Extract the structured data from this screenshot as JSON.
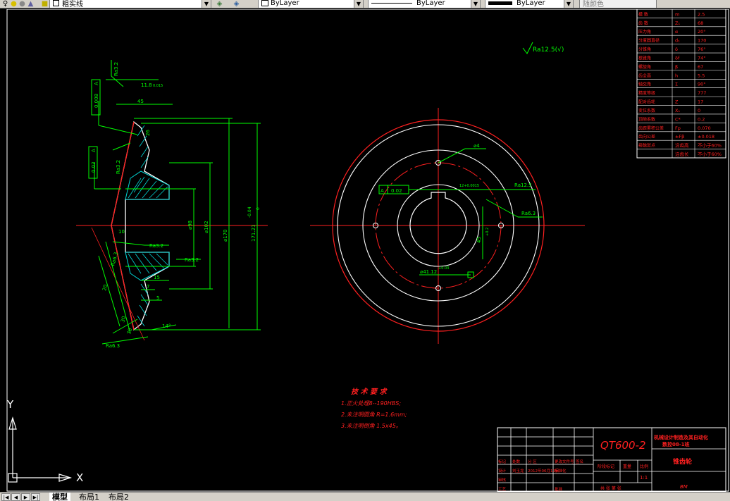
{
  "toolbar": {
    "layer_name": "粗实线",
    "color_value": "ByLayer",
    "linetype_value": "ByLayer",
    "lineweight_value": "ByLayer",
    "plotstyle_value": "随颜色"
  },
  "tabs": {
    "model": "模型",
    "layout1": "布局1",
    "layout2": "布局2"
  },
  "ucs": {
    "y_label": "Y",
    "x_label": "X"
  },
  "drawing": {
    "surface_finish_note": "Ra12.5(√)",
    "left_view": {
      "flatness_tol": "0.008",
      "runout_tol": "0.03",
      "datum": "A",
      "roughness_top": "Ra3.2",
      "roughness_left": "Ra3.2",
      "roughness_bore": "Ra3.2",
      "roughness_face": "Ra3.2",
      "roughness_tooth": "Ra6.3",
      "roughness_back": "Ra6.3",
      "dim_11_8": "11.8",
      "dim_11_8_tol": "0.015",
      "dim_45": "45",
      "dim_20": "20",
      "dim_15": "15",
      "dim_5": "5",
      "dim_7": "7",
      "dim_30": "30",
      "dim_26": "26",
      "dim_10": "10",
      "dim_70": "70",
      "dim_angle": "14°",
      "dia_98": "⌀98",
      "dia_102": "⌀102",
      "dia_170": "⌀170",
      "dia_171": "171.21",
      "dia_171_tol_upper": "-0.04",
      "dia_171_tol_lower": "0"
    },
    "front_view": {
      "hole_callout": "⌀4",
      "flat_tol": "0.02",
      "datum": "A",
      "keyway": "12+0.0015",
      "roughness_1": "Ra12.5",
      "roughness_2": "Ra6.3",
      "dim_45": "45",
      "dim_45_tol": "+0.2",
      "dim_41": "⌀41.12",
      "dim_41_tol": "+0.03"
    },
    "tech_requirements": {
      "title": "技 术 要 求",
      "items": [
        "1.正火处理8--190HBS;",
        "2.未注明圆角 R=1.6mm;",
        "3.未注明倒角 1.5x45。"
      ]
    },
    "params_table": [
      {
        "name": "模 数",
        "sym": "m",
        "val": "2.5"
      },
      {
        "name": "齿 数",
        "sym": "Z₁",
        "val": "68"
      },
      {
        "name": "压力角",
        "sym": "α",
        "val": "20°"
      },
      {
        "name": "分度圆直径",
        "sym": "d₁",
        "val": "170"
      },
      {
        "name": "分锥角",
        "sym": "δ",
        "val": "76°"
      },
      {
        "name": "根锥角",
        "sym": "δf",
        "val": "74°"
      },
      {
        "name": "螺旋角",
        "sym": "β",
        "val": "67"
      },
      {
        "name": "齿全高",
        "sym": "h",
        "val": "5.5"
      },
      {
        "name": "轴交角",
        "sym": "Σ",
        "val": "90°"
      },
      {
        "name": "精度等级",
        "sym": "",
        "val": "777"
      },
      {
        "name": "配对齿轮",
        "sym": "Z",
        "val": "17"
      },
      {
        "name": "变位系数",
        "sym": "X₁",
        "val": "0"
      },
      {
        "name": "顶隙系数",
        "sym": "C*",
        "val": "0.2"
      },
      {
        "name": "齿距累积公差",
        "sym": "Fp",
        "val": "0.070"
      },
      {
        "name": "齿向公差",
        "sym": "±Fβ",
        "val": "±0.018"
      },
      {
        "name": "接触斑点",
        "sym": "沿齿高",
        "val": "不小于60%"
      },
      {
        "name": "",
        "sym": "沿齿长",
        "val": "不小于60%"
      }
    ],
    "title_block": {
      "material": "QT600-2",
      "school_line1": "机械设计制造及其自动化",
      "school_line2": "数控08-1班",
      "part_name": "锥齿轮",
      "scale": "1:1",
      "stage_label": "阶段标记",
      "weight_label": "重量",
      "scale_label": "比例",
      "sheet_label": "共 张 第 张",
      "rows": [
        {
          "a": "标记",
          "b": "处数",
          "c": "分 区",
          "d": "更改文件号",
          "e": "签名"
        },
        {
          "a": "设计",
          "b": "刘玉龙",
          "c": "2012年06月11日",
          "d": "标准化",
          "e": ""
        },
        {
          "a": "审核",
          "b": "",
          "c": "",
          "d": "",
          "e": ""
        },
        {
          "a": "工艺",
          "b": "",
          "c": "",
          "d": "批准",
          "e": ""
        }
      ],
      "label_bottom": "BM"
    }
  }
}
